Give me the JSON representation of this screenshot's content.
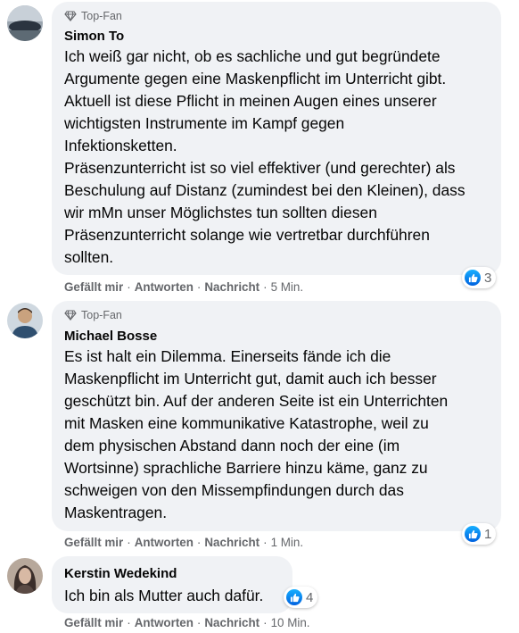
{
  "comments": [
    {
      "badge": "Top-Fan",
      "name": "Simon To",
      "text": "Ich weiß gar nicht, ob es sachliche und gut begründete\nArgumente gegen eine Maskenpflicht im Unterricht gibt.\nAktuell ist diese Pflicht in meinen Augen eines unserer\nwichtigsten Instrumente im Kampf gegen\nInfektionsketten.\nPräsenzunterricht ist so viel effektiver (und gerechter) als\nBeschulung auf Distanz (zumindest bei den Kleinen), dass\nwir mMn unser Möglichstes tun sollten diesen\nPräsenzunterricht solange wie vertretbar durchführen\nsollten.",
      "reaction_count": "3",
      "actions": {
        "like": "Gefällt mir",
        "reply": "Antworten",
        "message": "Nachricht",
        "time": "5 Min."
      },
      "avatar_colors": [
        "#2b3440",
        "#8e9aa6"
      ]
    },
    {
      "badge": "Top-Fan",
      "name": "Michael Bosse",
      "text": "Es ist halt ein Dilemma. Einerseits fände ich die\nMaskenpflicht im Unterricht gut, damit auch ich besser\ngeschützt bin. Auf der anderen Seite ist ein Unterrichten\nmit Masken eine kommunikative Katastrophe, weil zu\ndem physischen Abstand dann noch der eine (im\nWortsinne) sprachliche Barriere hinzu käme, ganz zu\nschweigen von den Missempfindungen durch das\nMaskentragen.",
      "reaction_count": "1",
      "actions": {
        "like": "Gefällt mir",
        "reply": "Antworten",
        "message": "Nachricht",
        "time": "1 Min."
      },
      "avatar_colors": [
        "#2f4f6f",
        "#c9a27e"
      ]
    },
    {
      "badge": "",
      "name": "Kerstin Wedekind",
      "text": "Ich bin als Mutter auch dafür.",
      "reaction_count": "4",
      "actions": {
        "like": "Gefällt mir",
        "reply": "Antworten",
        "message": "Nachricht",
        "time": "10 Min."
      },
      "avatar_colors": [
        "#3a2e2a",
        "#d8b9a4"
      ]
    }
  ],
  "separator": "·",
  "colors": {
    "bubble": "#f0f2f5",
    "meta": "#65676b",
    "like_blue": "#1877f2"
  }
}
